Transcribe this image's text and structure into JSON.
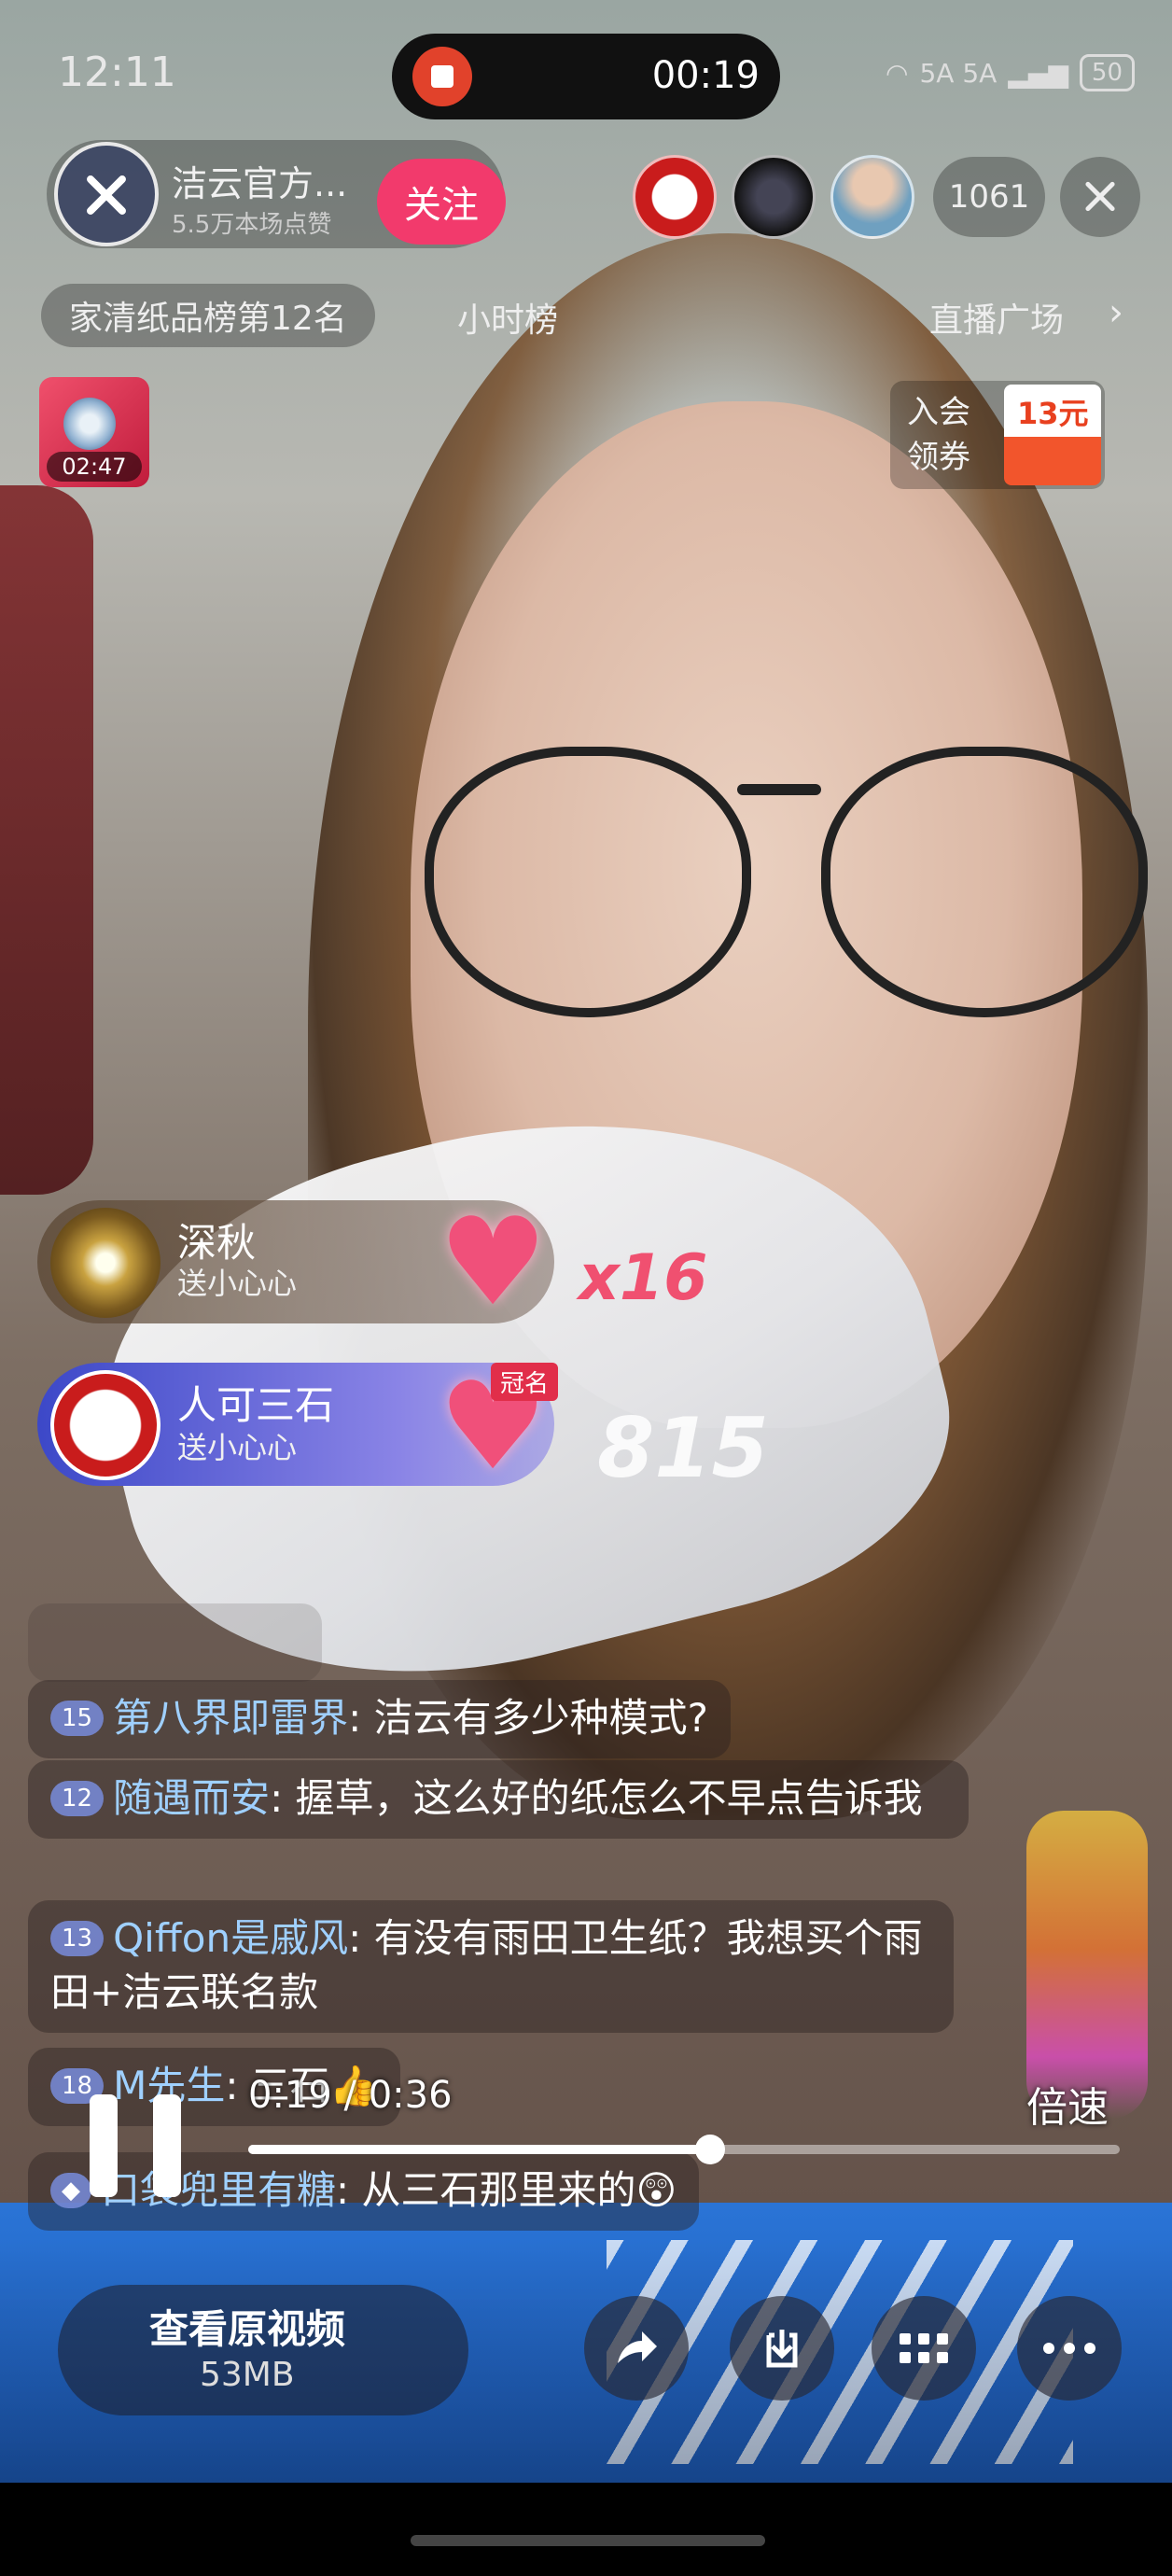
{
  "status_bar": {
    "time": "12:11",
    "record_time": "00:19",
    "network": "5A 5A",
    "battery": "50"
  },
  "live_header": {
    "streamer_name": "洁云官方...",
    "streamer_sub": "5.5万本场点赞",
    "follow_label": "关注",
    "viewer_count": "1061"
  },
  "ranking": {
    "rank_label": "家清纸品榜第12名",
    "hour_rank": "小时榜",
    "live_square": "直播广场"
  },
  "gift_thumbnail": {
    "timer": "02:47"
  },
  "coupon": {
    "line1": "入会",
    "line2": "领券",
    "amount": "13元"
  },
  "gifts": [
    {
      "user": "深秋",
      "action": "送小心心",
      "combo": "x16",
      "tag": ""
    },
    {
      "user": "人可三石",
      "action": "送小心心",
      "combo": "815",
      "tag": "冠名"
    }
  ],
  "comments": [
    {
      "level": "15",
      "user": "第八界即雷界",
      "text": "洁云有多少种模式?"
    },
    {
      "level": "12",
      "user": "随遇而安",
      "text": "握草，这么好的纸怎么不早点告诉我"
    },
    {
      "level": "13",
      "user": "Qiffon是戚风",
      "text": "有没有雨田卫生纸？我想买个雨田+洁云联名款"
    },
    {
      "level": "18",
      "user": "M先生",
      "text": "三石👍"
    },
    {
      "level": "",
      "user": "口袋兜里有糖",
      "text": "从三石那里来的😲"
    }
  ],
  "player": {
    "time_readout": "0:19 / 0:36",
    "speed_label": "倍速",
    "progress": 0.53,
    "view_original": "查看原视频",
    "file_size": "53MB"
  },
  "icons": {
    "share": "share-arrow-icon",
    "download": "download-icon",
    "grid": "grid-icon",
    "more": "more-icon"
  }
}
